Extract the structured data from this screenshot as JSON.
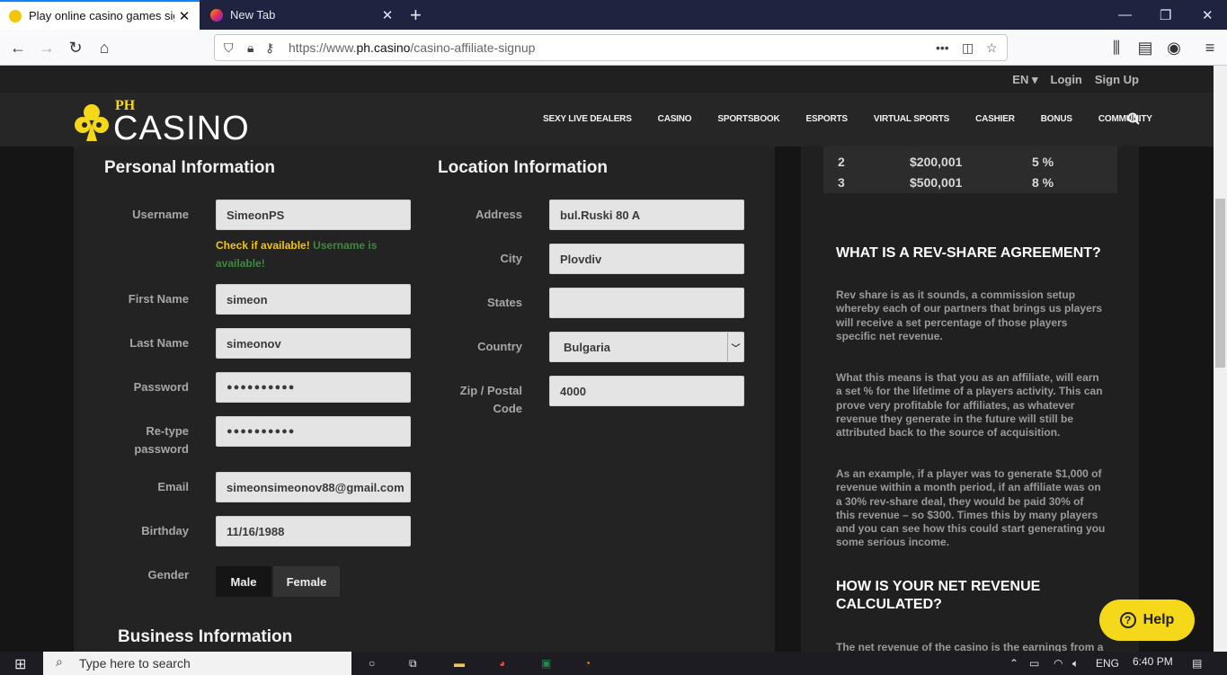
{
  "browser": {
    "tabs": [
      {
        "title": "Play online casino games sign",
        "active": true
      },
      {
        "title": "New Tab",
        "active": false
      }
    ],
    "url": {
      "prefix": "https://www.",
      "domain": "ph.casino",
      "path": "/casino-affiliate-signup"
    }
  },
  "site": {
    "toplinks": [
      "EN ▾",
      "Login",
      "Sign Up"
    ],
    "logo": {
      "small": "PH",
      "big": "CASINO"
    },
    "menu": [
      "SEXY LIVE DEALERS",
      "CASINO",
      "SPORTSBOOK",
      "ESPORTS",
      "VIRTUAL SPORTS",
      "CASHIER",
      "BONUS",
      "COMMUNITY"
    ]
  },
  "form": {
    "personal_title": "Personal Information",
    "location_title": "Location Information",
    "business_title": "Business Information",
    "username": {
      "label": "Username",
      "value": "SimeonPS"
    },
    "check": {
      "link": "Check if available!",
      "status": "Username is available!"
    },
    "first_name": {
      "label": "First Name",
      "value": "simeon"
    },
    "last_name": {
      "label": "Last Name",
      "value": "simeonov"
    },
    "password": {
      "label": "Password",
      "value": "●●●●●●●●●●"
    },
    "retype": {
      "label": "Re-type password",
      "value": "●●●●●●●●●●"
    },
    "email": {
      "label": "Email",
      "value": "simeonsimeonov88@gmail.com"
    },
    "birthday": {
      "label": "Birthday",
      "value": "11/16/1988"
    },
    "gender": {
      "label": "Gender",
      "male": "Male",
      "female": "Female",
      "selected": "Female"
    },
    "address": {
      "label": "Address",
      "value": "bul.Ruski 80 A"
    },
    "city": {
      "label": "City",
      "value": "Plovdiv"
    },
    "states": {
      "label": "States",
      "value": ""
    },
    "country": {
      "label": "Country",
      "value": "Bulgaria"
    },
    "zip": {
      "label": "Zip / Postal Code",
      "value": "4000"
    }
  },
  "side": {
    "table": [
      {
        "tier": "2",
        "amount": "$200,001",
        "pct": "5 %"
      },
      {
        "tier": "3",
        "amount": "$500,001",
        "pct": "8 %"
      }
    ],
    "h1": "WHAT IS A REV-SHARE AGREEMENT?",
    "p1": "Rev share is as it sounds, a commission setup whereby each of our partners that brings us players will receive a set percentage of those players specific net revenue.",
    "p2": "What this means is that you as an affiliate, will earn a set % for the lifetime of a players activity. This can prove very profitable for affiliates, as whatever revenue they generate in the future will still be attributed back to the source of acquisition.",
    "p3": "As an example, if a player was to generate $1,000 of revenue within a month period, if an affiliate was on a 30% rev-share deal, they would be paid 30% of this revenue – so $300. Times this by many players and you can see how this could start generating you some serious income.",
    "h2": "HOW IS YOUR NET REVENUE CALCULATED?",
    "p4": "The net revenue of the casino is the earnings from a"
  },
  "help": {
    "label": "Help"
  },
  "taskbar": {
    "search": "Type here to search",
    "lang": "ENG",
    "time": "6:40 PM"
  },
  "colors": {
    "accent": "#f5d81a",
    "available": "#3b8b3b",
    "check": "#f5c500"
  }
}
